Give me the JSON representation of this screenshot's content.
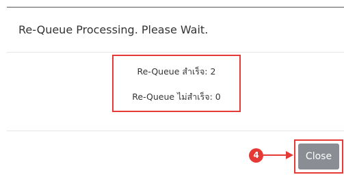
{
  "dialog": {
    "title": "Re-Queue Processing. Please Wait.",
    "result": {
      "success_line": "Re-Queue สำเร็จ: 2",
      "fail_line": "Re-Queue ไม่สำเร็จ: 0"
    },
    "step_badge": "4",
    "close_label": "Close"
  },
  "colors": {
    "annotation": "#e53935",
    "close_button": "#8a8d93"
  }
}
